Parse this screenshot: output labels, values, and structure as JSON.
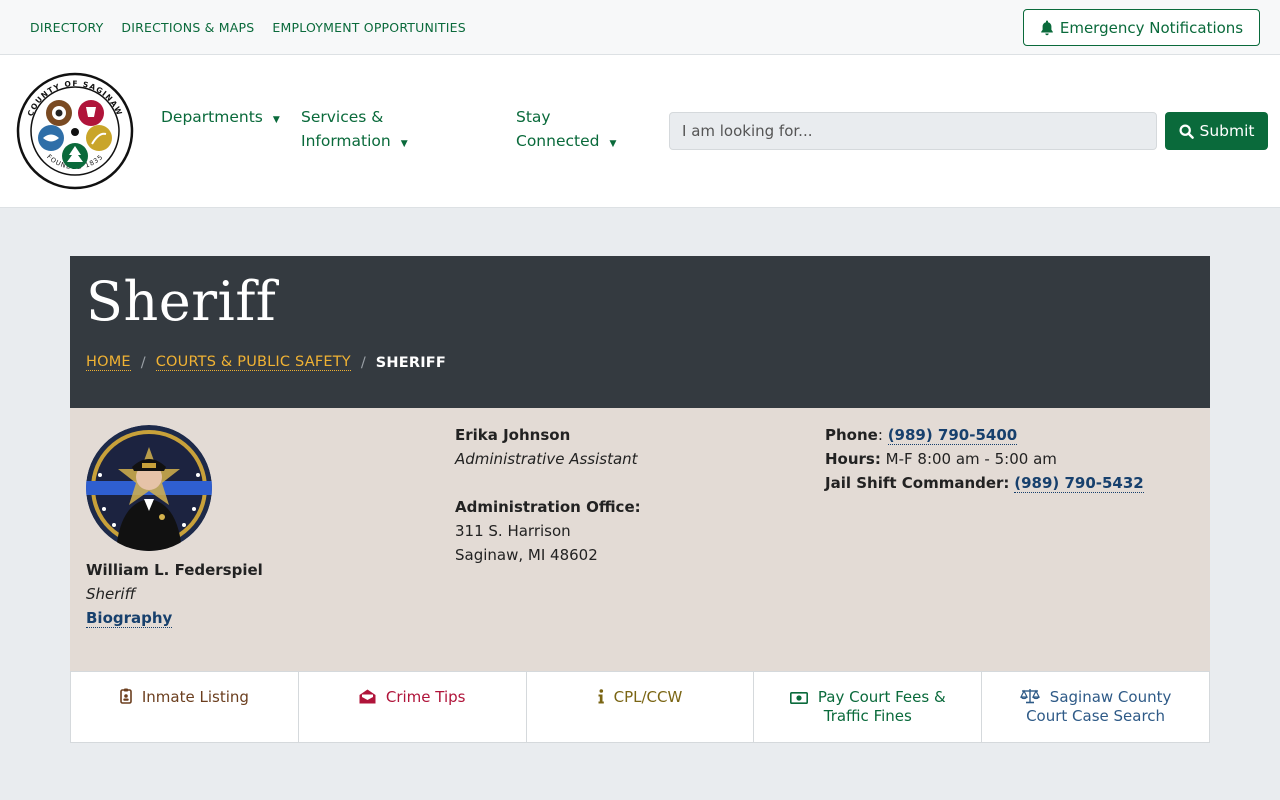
{
  "topbar": {
    "links": [
      "DIRECTORY",
      "DIRECTIONS & MAPS",
      "EMPLOYMENT OPPORTUNITIES"
    ],
    "emergency_label": "Emergency Notifications"
  },
  "nav": {
    "departments": "Departments",
    "services_line1": "Services &",
    "services_line2": "Information",
    "stay_line1": "Stay",
    "stay_line2": "Connected"
  },
  "search": {
    "placeholder": "I am looking for...",
    "submit_label": "Submit"
  },
  "page": {
    "title": "Sheriff",
    "breadcrumb": {
      "home": "HOME",
      "section": "COURTS & PUBLIC SAFETY",
      "current": "SHERIFF",
      "separator": "/"
    }
  },
  "sheriff": {
    "name": "William L. Federspiel",
    "title": "Sheriff",
    "bio_link": "Biography"
  },
  "assistant": {
    "name": "Erika Johnson",
    "title": "Administrative Assistant",
    "office_label": "Administration Office:",
    "address1": "311 S. Harrison",
    "address2": "Saginaw, MI 48602"
  },
  "contact": {
    "phone_label": "Phone",
    "phone_colon": ":",
    "phone": "(989) 790-5400",
    "hours_label": "Hours:",
    "hours": "M-F 8:00 am - 5:00 am",
    "jail_label": "Jail Shift Commander:",
    "jail_phone": "(989) 790-5432"
  },
  "tiles": [
    {
      "label": "Inmate Listing",
      "icon": "id-badge-icon",
      "color": "#6b3e1e"
    },
    {
      "label": "Crime Tips",
      "icon": "envelope-open-icon",
      "color": "#b0143a"
    },
    {
      "label": "CPL/CCW",
      "icon": "info-icon",
      "color": "#7a6514"
    },
    {
      "label_line1": "Pay Court Fees &",
      "label_line2": "Traffic Fines",
      "icon": "money-bill-icon",
      "color": "#0a6a3b"
    },
    {
      "label_line1": "Saginaw County",
      "label_line2": "Court Case Search",
      "icon": "balance-scale-icon",
      "color": "#2e5a87"
    }
  ],
  "logo": {
    "text_top": "COUNTY OF SAGINAW",
    "text_bottom": "FOUNDED 1835"
  },
  "colors": {
    "brand_green": "#0a6a3b",
    "hero_dark": "#343a40",
    "breadcrumb_gold": "#f0b233",
    "link_blue": "#17406d",
    "panel_tan": "#e3dbd5"
  }
}
